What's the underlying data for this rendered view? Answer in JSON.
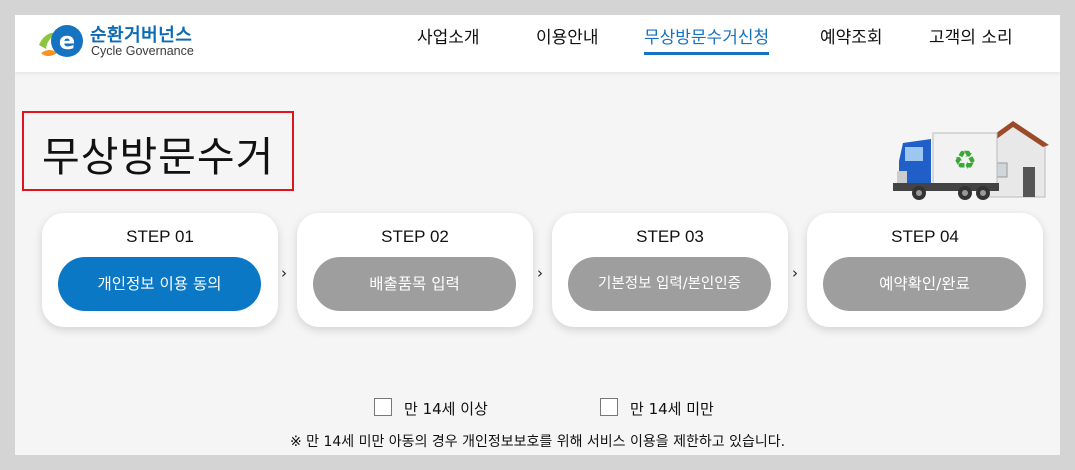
{
  "brand": {
    "name_ko": "순환거버넌스",
    "name_en": "Cycle Governance"
  },
  "nav": {
    "items": [
      {
        "label": "사업소개"
      },
      {
        "label": "이용안내"
      },
      {
        "label": "무상방문수거신청",
        "active": true
      },
      {
        "label": "예약조회"
      },
      {
        "label": "고객의 소리"
      }
    ]
  },
  "page": {
    "title": "무상방문수거"
  },
  "steps": [
    {
      "label": "STEP 01",
      "button": "개인정보 이용 동의",
      "active": true
    },
    {
      "label": "STEP 02",
      "button": "배출품목 입력",
      "active": false
    },
    {
      "label": "STEP 03",
      "button": "기본정보 입력/본인인증",
      "active": false
    },
    {
      "label": "STEP 04",
      "button": "예약확인/완료",
      "active": false
    }
  ],
  "step_arrow": "›",
  "age_options": [
    {
      "label": "만 14세 이상",
      "checked": false
    },
    {
      "label": "만 14세 미만",
      "checked": false
    }
  ],
  "notice": "※ 만 14세 미만 아동의 경우 개인정보보호를 위해 서비스 이용을 제한하고 있습니다.",
  "colors": {
    "accent": "#0b78c6",
    "inactive": "#9e9e9e",
    "highlight_border": "#e0141e"
  },
  "icons": {
    "logo": "e-leaf-logo",
    "illustration": "recycling-truck-house"
  }
}
